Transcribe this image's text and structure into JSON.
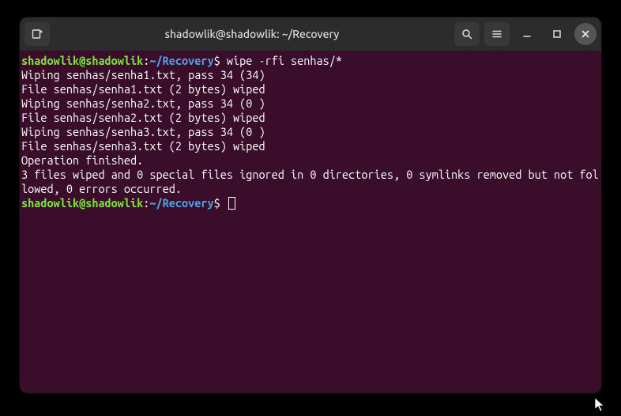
{
  "window": {
    "title": "shadowlik@shadowlik: ~/Recovery"
  },
  "prompt": {
    "user_host": "shadowlik@shadowlik",
    "colon": ":",
    "path": "~/Recovery",
    "symbol": "$"
  },
  "command": " wipe -rfi senhas/*",
  "output": [
    "Wiping senhas/senha1.txt, pass 34 (34)",
    "File senhas/senha1.txt (2 bytes) wiped",
    "Wiping senhas/senha2.txt, pass 34 (0 )",
    "File senhas/senha2.txt (2 bytes) wiped",
    "Wiping senhas/senha3.txt, pass 34 (0 )",
    "File senhas/senha3.txt (2 bytes) wiped",
    "Operation finished.",
    "3 files wiped and 0 special files ignored in 0 directories, 0 symlinks removed but not followed, 0 errors occurred."
  ],
  "icons": {
    "new_tab": "new-tab-icon",
    "search": "search-icon",
    "menu": "menu-icon",
    "minimize": "minimize-icon",
    "maximize": "maximize-icon",
    "close": "close-icon"
  }
}
